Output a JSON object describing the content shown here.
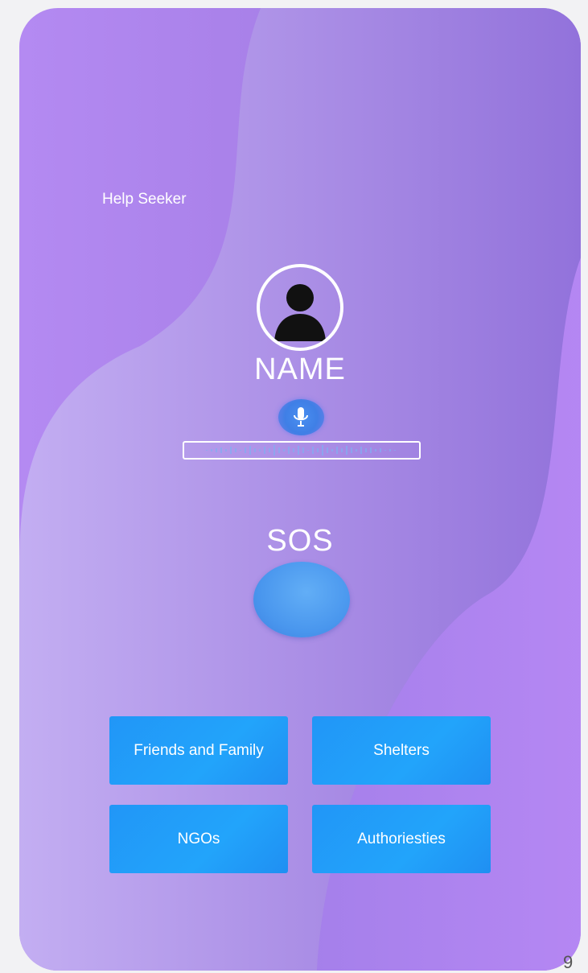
{
  "app": {
    "title": "Help Seeker"
  },
  "profile": {
    "avatar_icon": "user-avatar-icon",
    "name_label": "NAME"
  },
  "voice": {
    "mic_icon": "microphone-icon",
    "waveform_icon": "audio-waveform-icon"
  },
  "sos": {
    "label": "SOS"
  },
  "contacts": {
    "friends_family": "Friends and Family",
    "shelters": "Shelters",
    "ngos": "NGOs",
    "authorities": "Authoriesties"
  },
  "page_number": "9",
  "colors": {
    "background_purple": "#a57ee6",
    "tile_blue": "#22a4fb",
    "sos_blue": "#4a97ee",
    "mic_blue": "#3f7fe6",
    "text": "#ffffff"
  }
}
